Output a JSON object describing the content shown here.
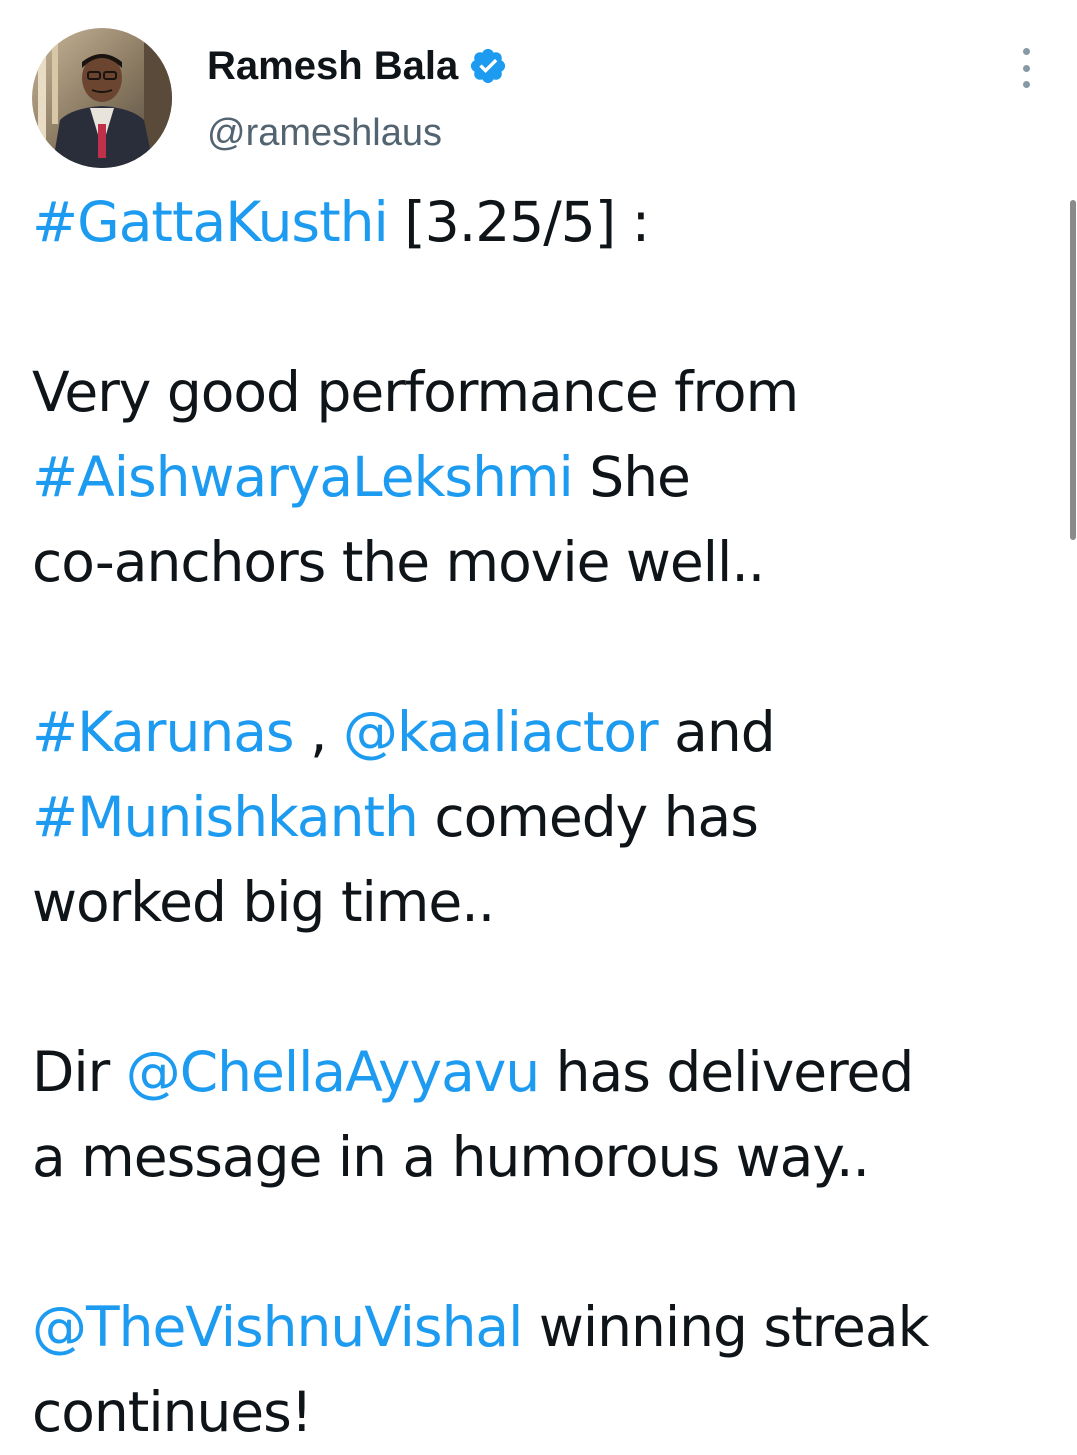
{
  "author": {
    "display_name": "Ramesh Bala",
    "handle": "@rameshlaus",
    "verified": true,
    "avatar_icon": "profile-photo",
    "verified_icon": "verified-badge-icon"
  },
  "colors": {
    "link": "#1d9bf0",
    "text": "#0f1419",
    "secondary": "#536471",
    "verified": "#1d9bf0"
  },
  "menu": {
    "icon": "more-vertical-icon"
  },
  "tweet": {
    "rating_hashtag": "#GattaKusthi",
    "rating_text": " [3.25/5] :",
    "p1_line1": "Very good performance from",
    "p1_hashtag": "#AishwaryaLekshmi",
    "p1_line2_rest": " She",
    "p1_line3": "co-anchors the movie well..",
    "p2_hashtag1": "#Karunas",
    "p2_sep": " , ",
    "p2_mention1": "@kaaliactor",
    "p2_and": " and",
    "p2_hashtag2": "#Munishkanth",
    "p2_line2_rest": " comedy has",
    "p2_line3": "worked big time..",
    "p3_dir": "Dir ",
    "p3_mention": "@ChellaAyyavu",
    "p3_line1_rest": " has delivered",
    "p3_line2": "a message in a humorous way..",
    "p4_mention": "@TheVishnuVishal",
    "p4_line1_rest": " winning streak",
    "p4_line2": "continues!"
  }
}
